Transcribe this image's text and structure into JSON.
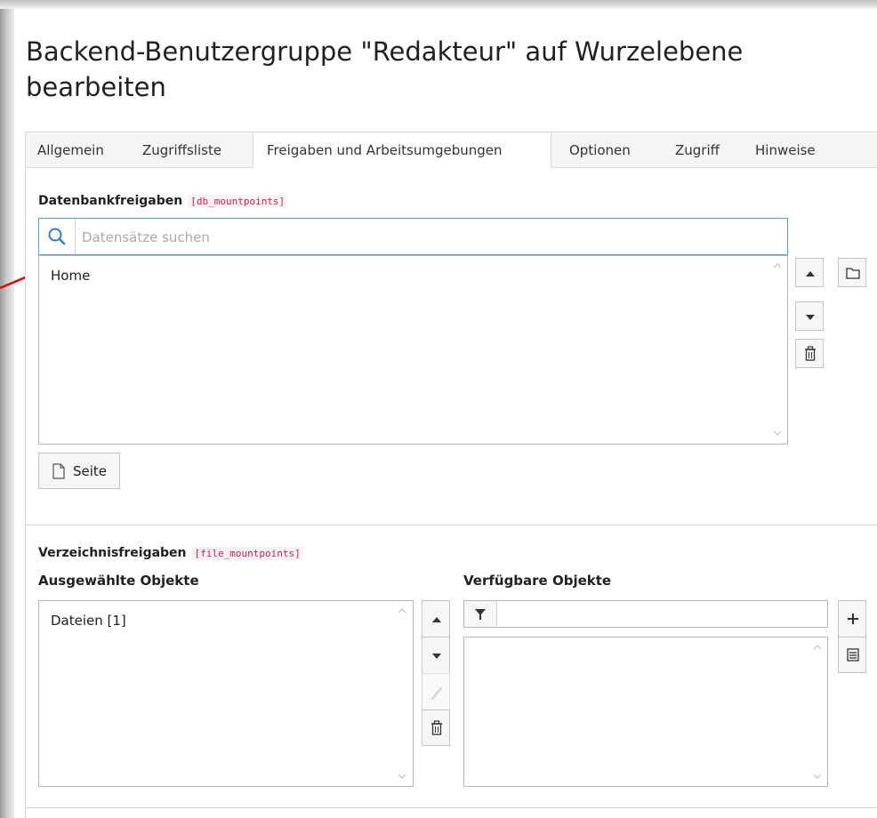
{
  "page": {
    "title_line1": "Backend-Benutzergruppe \"Redakteur\" auf Wurzelebene",
    "title_line2": "bearbeiten"
  },
  "tabs": [
    {
      "label": "Allgemein",
      "active": false
    },
    {
      "label": "Zugriffsliste",
      "active": false
    },
    {
      "label": "Freigaben und Arbeitsumgebungen",
      "active": true
    },
    {
      "label": "Optionen",
      "active": false
    },
    {
      "label": "Zugriff",
      "active": false
    },
    {
      "label": "Hinweise",
      "active": false
    }
  ],
  "db_mounts": {
    "label": "Datenbankfreigaben",
    "field_name": "[db_mountpoints]",
    "search_placeholder": "Datensätze suchen",
    "selected_items": [
      "Home"
    ],
    "add_page_button_label": "Seite",
    "icons": {
      "search": "search-icon",
      "move_up": "caret-up-icon",
      "move_down": "caret-down-icon",
      "delete": "trash-icon",
      "browse": "folder-icon",
      "page": "page-icon"
    }
  },
  "file_mounts": {
    "label": "Verzeichnisfreigaben",
    "field_name": "[file_mountpoints]",
    "selected_header": "Ausgewählte Objekte",
    "available_header": "Verfügbare Objekte",
    "selected_items": [
      "Dateien [1]"
    ],
    "available_items": [],
    "filter_value": "",
    "icons": {
      "move_up": "caret-up-icon",
      "move_down": "caret-down-icon",
      "edit": "pencil-icon",
      "delete": "trash-icon",
      "filter": "filter-icon",
      "add": "plus-icon",
      "list": "list-icon"
    }
  },
  "colors": {
    "accent_border": "#5f9fd3",
    "search_icon": "#2f7fc1",
    "field_name_text": "#c7254e",
    "annotation_arrow": "#e00000"
  }
}
